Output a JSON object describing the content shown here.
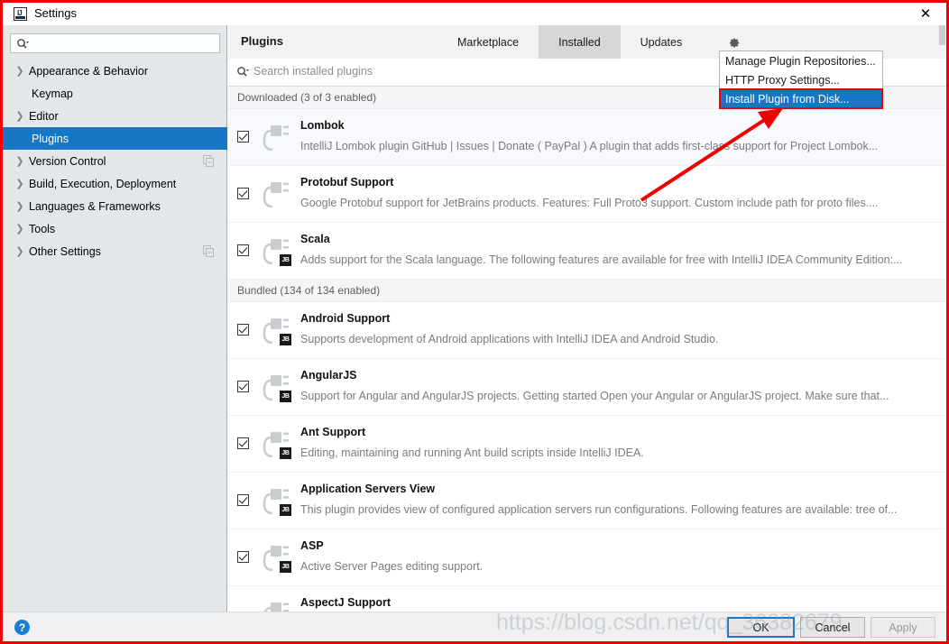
{
  "window": {
    "title": "Settings",
    "app_icon": "intellij-idea-icon",
    "close_label": "✕"
  },
  "sidebar": {
    "search_placeholder": "",
    "search_icon": "search-icon",
    "items": [
      {
        "label": "Appearance & Behavior",
        "expandable": true,
        "selected": false,
        "badge": false
      },
      {
        "label": "Keymap",
        "expandable": false,
        "selected": false,
        "badge": false
      },
      {
        "label": "Editor",
        "expandable": true,
        "selected": false,
        "badge": false
      },
      {
        "label": "Plugins",
        "expandable": false,
        "selected": true,
        "badge": false
      },
      {
        "label": "Version Control",
        "expandable": true,
        "selected": false,
        "badge": true
      },
      {
        "label": "Build, Execution, Deployment",
        "expandable": true,
        "selected": false,
        "badge": false
      },
      {
        "label": "Languages & Frameworks",
        "expandable": true,
        "selected": false,
        "badge": false
      },
      {
        "label": "Tools",
        "expandable": true,
        "selected": false,
        "badge": false
      },
      {
        "label": "Other Settings",
        "expandable": true,
        "selected": false,
        "badge": true
      }
    ]
  },
  "panel": {
    "title": "Plugins",
    "tabs": [
      {
        "label": "Marketplace",
        "active": false
      },
      {
        "label": "Installed",
        "active": true
      },
      {
        "label": "Updates",
        "active": false
      }
    ],
    "gear_icon": "gear-icon",
    "search": {
      "icon": "search-icon",
      "placeholder": "Search installed plugins"
    }
  },
  "menu": {
    "items": [
      {
        "label": "Manage Plugin Repositories...",
        "highlight": false,
        "outlined": false
      },
      {
        "label": "HTTP Proxy Settings...",
        "highlight": false,
        "outlined": false
      },
      {
        "label": "Install Plugin from Disk...",
        "highlight": true,
        "outlined": true
      }
    ]
  },
  "groups": [
    {
      "header": "Downloaded (3 of 3 enabled)",
      "plugins": [
        {
          "name": "Lombok",
          "description": "IntelliJ Lombok plugin GitHub | Issues | Donate ( PayPal ) A plugin that adds first-class support for Project Lombok...",
          "checked": true,
          "jb_badge": false,
          "tinted": true
        },
        {
          "name": "Protobuf Support",
          "description": "Google Protobuf support for JetBrains products. Features: Full Proto3 support. Custom include path for proto files....",
          "checked": true,
          "jb_badge": false,
          "tinted": false
        },
        {
          "name": "Scala",
          "description": "Adds support for the Scala language. The following features are available for free with IntelliJ IDEA Community Edition:...",
          "checked": true,
          "jb_badge": true,
          "tinted": false
        }
      ]
    },
    {
      "header": "Bundled (134 of 134 enabled)",
      "plugins": [
        {
          "name": "Android Support",
          "description": "Supports development of Android applications with IntelliJ IDEA and Android Studio.",
          "checked": true,
          "jb_badge": true,
          "tinted": false
        },
        {
          "name": "AngularJS",
          "description": "Support for Angular and AngularJS projects. Getting started Open your Angular or AngularJS project. Make sure that...",
          "checked": true,
          "jb_badge": true,
          "tinted": false
        },
        {
          "name": "Ant Support",
          "description": "Editing, maintaining and running Ant build scripts inside IntelliJ IDEA.",
          "checked": true,
          "jb_badge": true,
          "tinted": false
        },
        {
          "name": "Application Servers View",
          "description": "This plugin provides view of configured application servers run configurations. Following features are available: tree of...",
          "checked": true,
          "jb_badge": true,
          "tinted": false
        },
        {
          "name": "ASP",
          "description": "Active Server Pages editing support.",
          "checked": true,
          "jb_badge": true,
          "tinted": false
        },
        {
          "name": "AspectJ Support",
          "description": "",
          "checked": false,
          "jb_badge": false,
          "tinted": false
        }
      ]
    }
  ],
  "footer": {
    "help_label": "?",
    "ok_label": "OK",
    "cancel_label": "Cancel",
    "apply_label": "Apply"
  },
  "watermark": {
    "text": "https://blog.csdn.net/qq_36382679"
  },
  "colors": {
    "accent": "#1777c4",
    "annotation_red": "#f00000",
    "sidebar_bg": "#e3e7ea",
    "tab_active_bg": "#d7d7d7"
  }
}
